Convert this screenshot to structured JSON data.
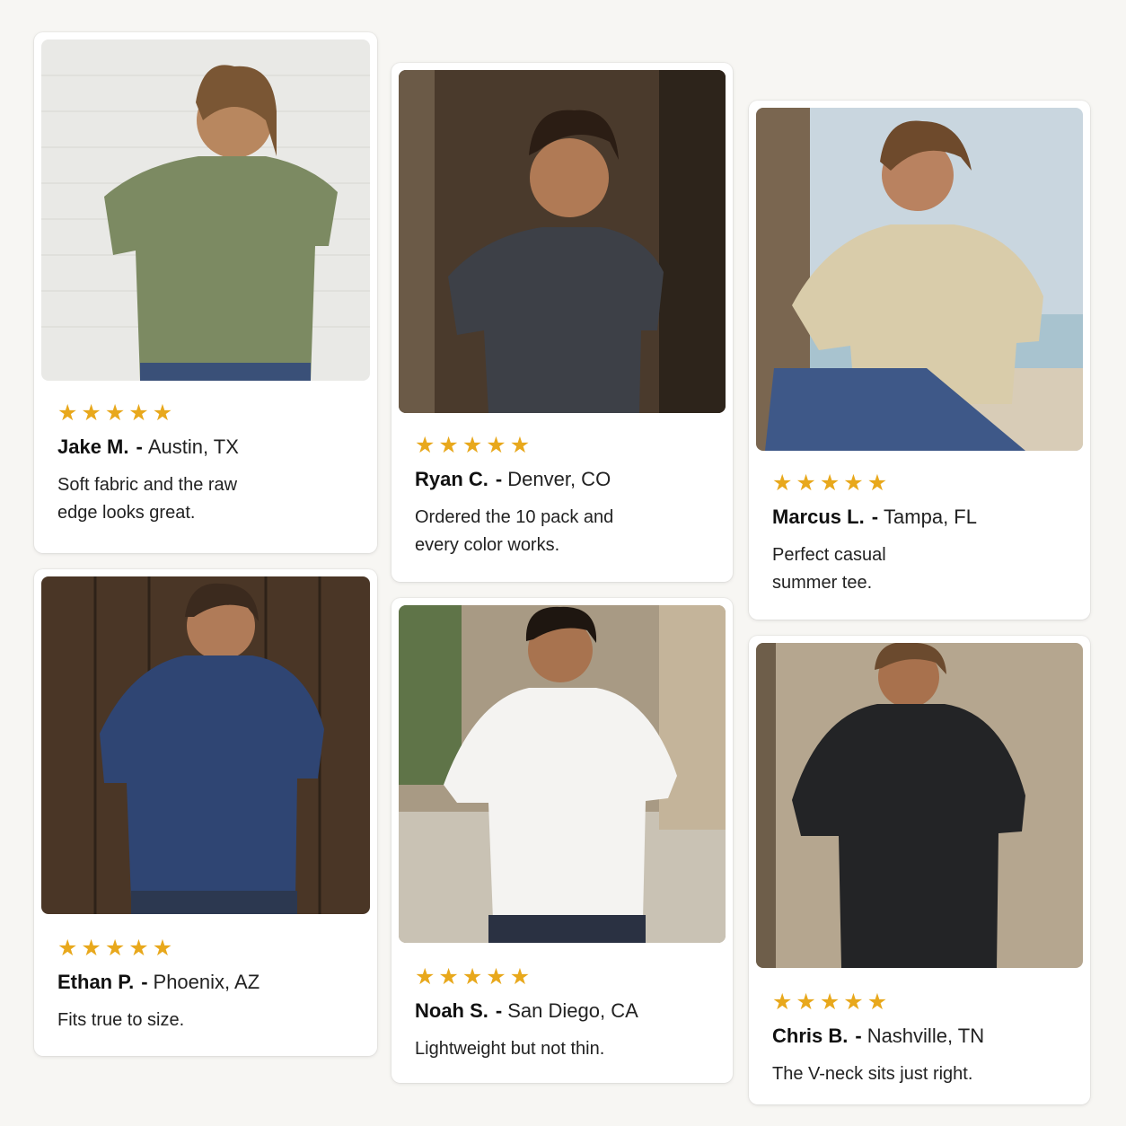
{
  "colors": {
    "background": "#f7f6f3",
    "card": "#ffffff",
    "star": "#e8a81c"
  },
  "reviews": [
    {
      "stars": [
        "★",
        "★",
        "★",
        "★",
        "★"
      ],
      "name": "Jake M.",
      "separator": "-",
      "location": "Austin, TX",
      "text_lines": [
        "Soft fabric and the raw",
        "edge looks great."
      ],
      "shirt_color": "#7c8a62",
      "backdrop_color": "#e9e9e6"
    },
    {
      "stars": [
        "★",
        "★",
        "★",
        "★",
        "★"
      ],
      "name": "Ryan C.",
      "separator": "-",
      "location": "Denver, CO",
      "text_lines": [
        "Ordered the 10 pack and",
        "every color works."
      ],
      "shirt_color": "#3d4047",
      "backdrop_color": "#4a3a2c"
    },
    {
      "stars": [
        "★",
        "★",
        "★",
        "★",
        "★"
      ],
      "name": "Marcus L.",
      "separator": "-",
      "location": "Tampa, FL",
      "text_lines": [
        "Perfect casual",
        "summer tee."
      ],
      "shirt_color": "#d9ccaa",
      "backdrop_color": "#c9d6df"
    },
    {
      "stars": [
        "★",
        "★",
        "★",
        "★",
        "★"
      ],
      "name": "Ethan P.",
      "separator": "-",
      "location": "Phoenix, AZ",
      "text_lines": [
        "Fits true to size."
      ],
      "shirt_color": "#2f4573",
      "backdrop_color": "#4a3626"
    },
    {
      "stars": [
        "★",
        "★",
        "★",
        "★",
        "★"
      ],
      "name": "Noah S.",
      "separator": "-",
      "location": "San Diego, CA",
      "text_lines": [
        "Lightweight but not thin."
      ],
      "shirt_color": "#f4f3f1",
      "backdrop_color": "#a89a84"
    },
    {
      "stars": [
        "★",
        "★",
        "★",
        "★",
        "★"
      ],
      "name": "Chris B.",
      "separator": "-",
      "location": "Nashville, TN",
      "text_lines": [
        "The V-neck sits just right."
      ],
      "shirt_color": "#232426",
      "backdrop_color": "#b5a68f"
    }
  ]
}
